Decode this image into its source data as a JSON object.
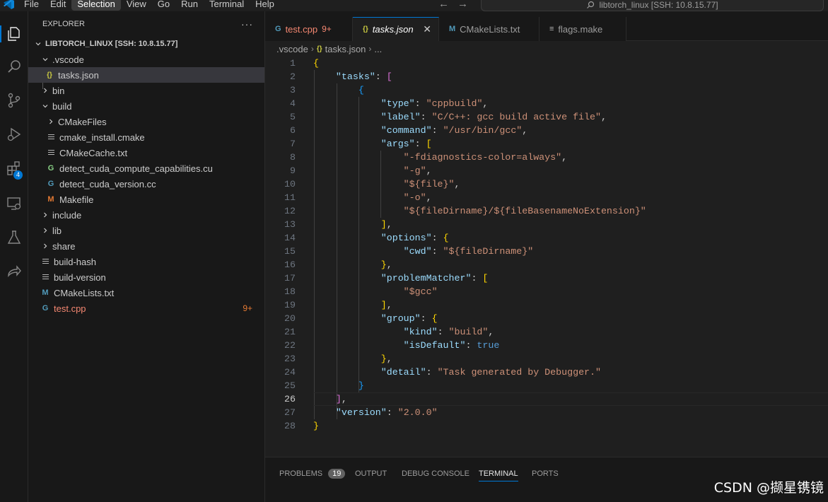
{
  "menu": [
    "File",
    "Edit",
    "Selection",
    "View",
    "Go",
    "Run",
    "Terminal",
    "Help"
  ],
  "command_center": "libtorch_linux [SSH: 10.8.15.77]",
  "activity_badge": "4",
  "explorer": {
    "title": "EXPLORER",
    "more": "···",
    "root": "LIBTORCH_LINUX [SSH: 10.8.15.77]",
    "items": [
      {
        "label": ".vscode",
        "count": ""
      },
      {
        "label": "tasks.json",
        "count": ""
      },
      {
        "label": "bin",
        "count": ""
      },
      {
        "label": "build",
        "count": ""
      },
      {
        "label": "CMakeFiles",
        "count": ""
      },
      {
        "label": "cmake_install.cmake",
        "count": ""
      },
      {
        "label": "CMakeCache.txt",
        "count": ""
      },
      {
        "label": "detect_cuda_compute_capabilities.cu",
        "count": ""
      },
      {
        "label": "detect_cuda_version.cc",
        "count": ""
      },
      {
        "label": "Makefile",
        "count": ""
      },
      {
        "label": "include",
        "count": ""
      },
      {
        "label": "lib",
        "count": ""
      },
      {
        "label": "share",
        "count": ""
      },
      {
        "label": "build-hash",
        "count": ""
      },
      {
        "label": "build-version",
        "count": ""
      },
      {
        "label": "CMakeLists.txt",
        "count": ""
      },
      {
        "label": "test.cpp",
        "count": "9+"
      }
    ]
  },
  "tabs": [
    {
      "label": "test.cpp",
      "count": "9+",
      "icon": "G"
    },
    {
      "label": "tasks.json",
      "close": "✕",
      "icon": "{}"
    },
    {
      "label": "CMakeLists.txt",
      "icon": "M"
    },
    {
      "label": "flags.make",
      "icon": "≡"
    }
  ],
  "breadcrumb": [
    ".vscode",
    "tasks.json",
    "..."
  ],
  "editor": {
    "current_line": 26,
    "line_numbers": [
      "1",
      "2",
      "3",
      "4",
      "5",
      "6",
      "7",
      "8",
      "9",
      "10",
      "11",
      "12",
      "13",
      "14",
      "15",
      "16",
      "17",
      "18",
      "19",
      "20",
      "21",
      "22",
      "23",
      "24",
      "25",
      "26",
      "27",
      "28"
    ],
    "tokens": {
      "tasks": "\"tasks\"",
      "type_k": "\"type\"",
      "type_v": "\"cppbuild\"",
      "label_k": "\"label\"",
      "label_v": "\"C/C++: gcc build active file\"",
      "command_k": "\"command\"",
      "command_v": "\"/usr/bin/gcc\"",
      "args_k": "\"args\"",
      "arg1": "\"-fdiagnostics-color=always\"",
      "arg2": "\"-g\"",
      "arg3": "\"${file}\"",
      "arg4": "\"-o\"",
      "arg5": "\"${fileDirname}/${fileBasenameNoExtension}\"",
      "options_k": "\"options\"",
      "cwd_k": "\"cwd\"",
      "cwd_v": "\"${fileDirname}\"",
      "pm_k": "\"problemMatcher\"",
      "pm_v": "\"$gcc\"",
      "group_k": "\"group\"",
      "kind_k": "\"kind\"",
      "kind_v": "\"build\"",
      "isdef_k": "\"isDefault\"",
      "isdef_v": "true",
      "detail_k": "\"detail\"",
      "detail_v": "\"Task generated by Debugger.\"",
      "version_k": "\"version\"",
      "version_v": "\"2.0.0\""
    }
  },
  "panel": {
    "tabs": [
      "PROBLEMS",
      "OUTPUT",
      "DEBUG CONSOLE",
      "TERMINAL",
      "PORTS"
    ],
    "problems_count": "19",
    "active": "TERMINAL"
  },
  "watermark": "CSDN @撷星镌镜"
}
